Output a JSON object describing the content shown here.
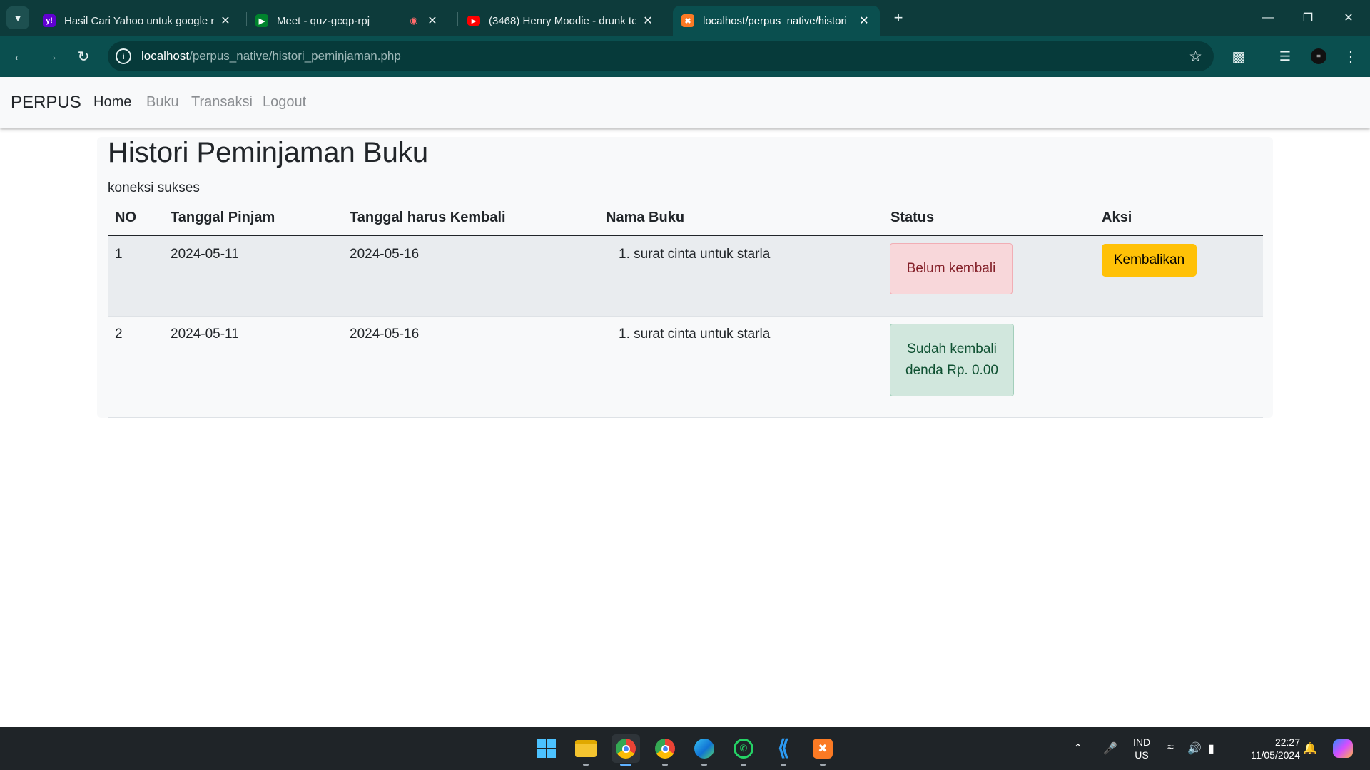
{
  "browser": {
    "tabs": [
      {
        "title": "Hasil Cari Yahoo untuk google r",
        "favicon": "yahoo-icon",
        "active": false
      },
      {
        "title": "Meet - quz-gcqp-rpj",
        "favicon": "google-meet-icon",
        "active": false
      },
      {
        "title": "(3468) Henry Moodie - drunk te",
        "favicon": "youtube-icon",
        "active": false
      },
      {
        "title": "localhost/perpus_native/histori_",
        "favicon": "xampp-icon",
        "active": true
      }
    ],
    "url_host": "localhost",
    "url_path": "/perpus_native/histori_peminjaman.php"
  },
  "navbar": {
    "brand": "PERPUS",
    "links": [
      "Home",
      "Buku",
      "Transaksi",
      "Logout"
    ],
    "active_link": "Home"
  },
  "page": {
    "title": "Histori Peminjaman Buku",
    "connection_status": "koneksi sukses"
  },
  "table": {
    "headers": [
      "NO",
      "Tanggal Pinjam",
      "Tanggal harus Kembali",
      "Nama Buku",
      "Status",
      "Aksi"
    ],
    "rows": [
      {
        "no": "1",
        "tanggal_pinjam": "2024-05-11",
        "tanggal_kembali": "2024-05-16",
        "nama_buku": "1. surat cinta untuk starla",
        "status_lines": [
          "Belum kembali"
        ],
        "status_type": "danger",
        "aksi": "Kembalikan"
      },
      {
        "no": "2",
        "tanggal_pinjam": "2024-05-11",
        "tanggal_kembali": "2024-05-16",
        "nama_buku": "1. surat cinta untuk starla",
        "status_lines": [
          "Sudah kembali",
          "denda Rp. 0.00"
        ],
        "status_type": "success",
        "aksi": ""
      }
    ]
  },
  "taskbar": {
    "apps": [
      "windows-start-icon",
      "file-explorer-icon",
      "chrome-icon",
      "chrome-profile-icon",
      "edge-icon",
      "whatsapp-icon",
      "vscode-icon",
      "xampp-icon"
    ],
    "language_line1": "IND",
    "language_line2": "US",
    "time": "22:27",
    "date": "11/05/2024"
  },
  "colors": {
    "chrome_frame": "#0d3b3b",
    "chrome_toolbar": "#0a4f4f",
    "navbar_bg": "#f8f9fa",
    "row_stripe": "#e9ecef",
    "badge_danger_bg": "#f8d7da",
    "badge_success_bg": "#d1e7dd",
    "btn_warning": "#ffc107",
    "taskbar_bg": "#1f2428"
  }
}
